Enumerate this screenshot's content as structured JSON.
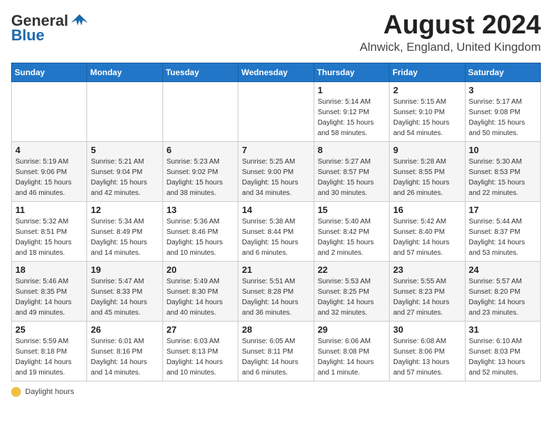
{
  "header": {
    "logo_general": "General",
    "logo_blue": "Blue",
    "month_title": "August 2024",
    "location": "Alnwick, England, United Kingdom"
  },
  "days_of_week": [
    "Sunday",
    "Monday",
    "Tuesday",
    "Wednesday",
    "Thursday",
    "Friday",
    "Saturday"
  ],
  "weeks": [
    [
      {
        "day": "",
        "info": ""
      },
      {
        "day": "",
        "info": ""
      },
      {
        "day": "",
        "info": ""
      },
      {
        "day": "",
        "info": ""
      },
      {
        "day": "1",
        "info": "Sunrise: 5:14 AM\nSunset: 9:12 PM\nDaylight: 15 hours\nand 58 minutes."
      },
      {
        "day": "2",
        "info": "Sunrise: 5:15 AM\nSunset: 9:10 PM\nDaylight: 15 hours\nand 54 minutes."
      },
      {
        "day": "3",
        "info": "Sunrise: 5:17 AM\nSunset: 9:08 PM\nDaylight: 15 hours\nand 50 minutes."
      }
    ],
    [
      {
        "day": "4",
        "info": "Sunrise: 5:19 AM\nSunset: 9:06 PM\nDaylight: 15 hours\nand 46 minutes."
      },
      {
        "day": "5",
        "info": "Sunrise: 5:21 AM\nSunset: 9:04 PM\nDaylight: 15 hours\nand 42 minutes."
      },
      {
        "day": "6",
        "info": "Sunrise: 5:23 AM\nSunset: 9:02 PM\nDaylight: 15 hours\nand 38 minutes."
      },
      {
        "day": "7",
        "info": "Sunrise: 5:25 AM\nSunset: 9:00 PM\nDaylight: 15 hours\nand 34 minutes."
      },
      {
        "day": "8",
        "info": "Sunrise: 5:27 AM\nSunset: 8:57 PM\nDaylight: 15 hours\nand 30 minutes."
      },
      {
        "day": "9",
        "info": "Sunrise: 5:28 AM\nSunset: 8:55 PM\nDaylight: 15 hours\nand 26 minutes."
      },
      {
        "day": "10",
        "info": "Sunrise: 5:30 AM\nSunset: 8:53 PM\nDaylight: 15 hours\nand 22 minutes."
      }
    ],
    [
      {
        "day": "11",
        "info": "Sunrise: 5:32 AM\nSunset: 8:51 PM\nDaylight: 15 hours\nand 18 minutes."
      },
      {
        "day": "12",
        "info": "Sunrise: 5:34 AM\nSunset: 8:49 PM\nDaylight: 15 hours\nand 14 minutes."
      },
      {
        "day": "13",
        "info": "Sunrise: 5:36 AM\nSunset: 8:46 PM\nDaylight: 15 hours\nand 10 minutes."
      },
      {
        "day": "14",
        "info": "Sunrise: 5:38 AM\nSunset: 8:44 PM\nDaylight: 15 hours\nand 6 minutes."
      },
      {
        "day": "15",
        "info": "Sunrise: 5:40 AM\nSunset: 8:42 PM\nDaylight: 15 hours\nand 2 minutes."
      },
      {
        "day": "16",
        "info": "Sunrise: 5:42 AM\nSunset: 8:40 PM\nDaylight: 14 hours\nand 57 minutes."
      },
      {
        "day": "17",
        "info": "Sunrise: 5:44 AM\nSunset: 8:37 PM\nDaylight: 14 hours\nand 53 minutes."
      }
    ],
    [
      {
        "day": "18",
        "info": "Sunrise: 5:46 AM\nSunset: 8:35 PM\nDaylight: 14 hours\nand 49 minutes."
      },
      {
        "day": "19",
        "info": "Sunrise: 5:47 AM\nSunset: 8:33 PM\nDaylight: 14 hours\nand 45 minutes."
      },
      {
        "day": "20",
        "info": "Sunrise: 5:49 AM\nSunset: 8:30 PM\nDaylight: 14 hours\nand 40 minutes."
      },
      {
        "day": "21",
        "info": "Sunrise: 5:51 AM\nSunset: 8:28 PM\nDaylight: 14 hours\nand 36 minutes."
      },
      {
        "day": "22",
        "info": "Sunrise: 5:53 AM\nSunset: 8:25 PM\nDaylight: 14 hours\nand 32 minutes."
      },
      {
        "day": "23",
        "info": "Sunrise: 5:55 AM\nSunset: 8:23 PM\nDaylight: 14 hours\nand 27 minutes."
      },
      {
        "day": "24",
        "info": "Sunrise: 5:57 AM\nSunset: 8:20 PM\nDaylight: 14 hours\nand 23 minutes."
      }
    ],
    [
      {
        "day": "25",
        "info": "Sunrise: 5:59 AM\nSunset: 8:18 PM\nDaylight: 14 hours\nand 19 minutes."
      },
      {
        "day": "26",
        "info": "Sunrise: 6:01 AM\nSunset: 8:16 PM\nDaylight: 14 hours\nand 14 minutes."
      },
      {
        "day": "27",
        "info": "Sunrise: 6:03 AM\nSunset: 8:13 PM\nDaylight: 14 hours\nand 10 minutes."
      },
      {
        "day": "28",
        "info": "Sunrise: 6:05 AM\nSunset: 8:11 PM\nDaylight: 14 hours\nand 6 minutes."
      },
      {
        "day": "29",
        "info": "Sunrise: 6:06 AM\nSunset: 8:08 PM\nDaylight: 14 hours\nand 1 minute."
      },
      {
        "day": "30",
        "info": "Sunrise: 6:08 AM\nSunset: 8:06 PM\nDaylight: 13 hours\nand 57 minutes."
      },
      {
        "day": "31",
        "info": "Sunrise: 6:10 AM\nSunset: 8:03 PM\nDaylight: 13 hours\nand 52 minutes."
      }
    ]
  ],
  "footer": {
    "daylight_label": "Daylight hours"
  }
}
